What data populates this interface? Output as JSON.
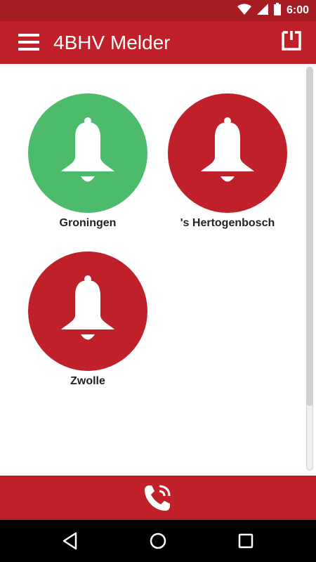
{
  "status_bar": {
    "time": "6:00",
    "icons": [
      "wifi-icon",
      "signal-icon",
      "battery-icon"
    ]
  },
  "app_bar": {
    "title": "4BHV Melder",
    "menu_icon": "hamburger-menu-icon",
    "action_icon": "logout-icon"
  },
  "colors": {
    "primary": "#c0202a",
    "status_bar": "#a51d23",
    "ok": "#4cbb6c",
    "alarm": "#c0202a"
  },
  "locations": [
    {
      "name": "Groningen",
      "status": "ok",
      "color": "#4cbb6c",
      "icon": "bell-icon"
    },
    {
      "name": "'s Hertogenbosch",
      "status": "alarm",
      "color": "#c0202a",
      "icon": "bell-icon"
    },
    {
      "name": "Zwolle",
      "status": "alarm",
      "color": "#c0202a",
      "icon": "bell-icon"
    }
  ],
  "footer": {
    "icon": "phone-ringing-icon"
  },
  "nav_bar": {
    "icons": [
      "back-icon",
      "home-icon",
      "recents-icon"
    ]
  }
}
